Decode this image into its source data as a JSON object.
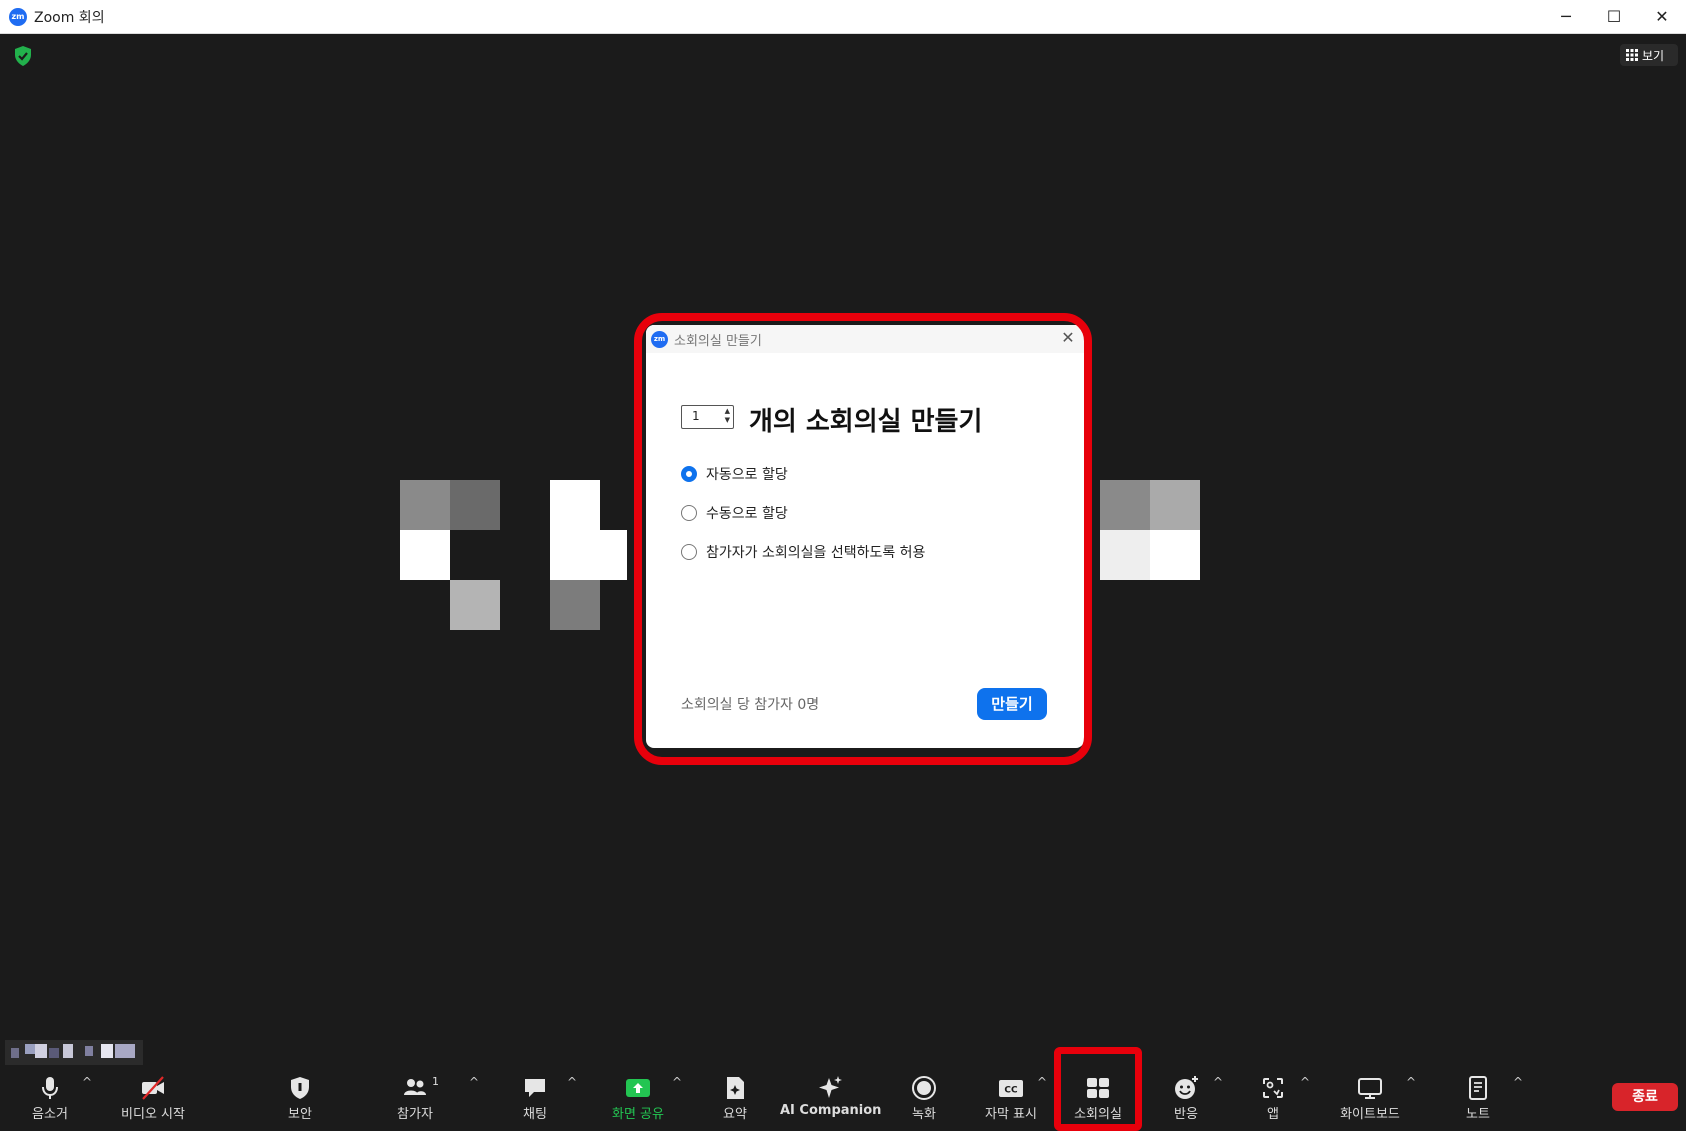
{
  "window": {
    "title": "Zoom 회의",
    "logo_text": "zm",
    "minimize_icon": "─",
    "maximize_icon": "☐",
    "close_icon": "✕"
  },
  "view_button": {
    "label": "보기"
  },
  "dialog": {
    "logo_text": "zm",
    "title": "소회의실 만들기",
    "close_icon": "✕",
    "room_count": "1",
    "stepper_arrows": "▲▼",
    "heading": "개의 소회의실 만들기",
    "options": [
      {
        "label": "자동으로 할당",
        "checked": true
      },
      {
        "label": "수동으로 할당",
        "checked": false
      },
      {
        "label": "참가자가 소회의실을 선택하도록 허용",
        "checked": false
      }
    ],
    "per_room_text": "소회의실 당 참가자 0명",
    "create_button": "만들기"
  },
  "toolbar": {
    "items": [
      {
        "label": "음소거",
        "icon": "microphone-icon"
      },
      {
        "label": "비디오 시작",
        "icon": "video-off-icon"
      },
      {
        "label": "보안",
        "icon": "shield-icon"
      },
      {
        "label": "참가자",
        "icon": "participants-icon",
        "badge": "1"
      },
      {
        "label": "채팅",
        "icon": "chat-icon"
      },
      {
        "label": "화면 공유",
        "icon": "share-screen-icon"
      },
      {
        "label": "요약",
        "icon": "summary-icon"
      },
      {
        "label": "AI Companion",
        "icon": "ai-companion-icon"
      },
      {
        "label": "녹화",
        "icon": "record-icon"
      },
      {
        "label": "자막 표시",
        "icon": "captions-icon",
        "icon_text": "CC"
      },
      {
        "label": "소회의실",
        "icon": "breakout-rooms-icon"
      },
      {
        "label": "반응",
        "icon": "reactions-icon"
      },
      {
        "label": "앱",
        "icon": "apps-icon"
      },
      {
        "label": "화이트보드",
        "icon": "whiteboard-icon"
      },
      {
        "label": "노트",
        "icon": "notes-icon"
      }
    ],
    "caret": "^",
    "end_button": "종료"
  },
  "colors": {
    "background": "#1b1b1b",
    "accent": "#0e72ed",
    "share_green": "#23c552",
    "end_red": "#d8242a",
    "highlight_red": "#e8000b"
  }
}
